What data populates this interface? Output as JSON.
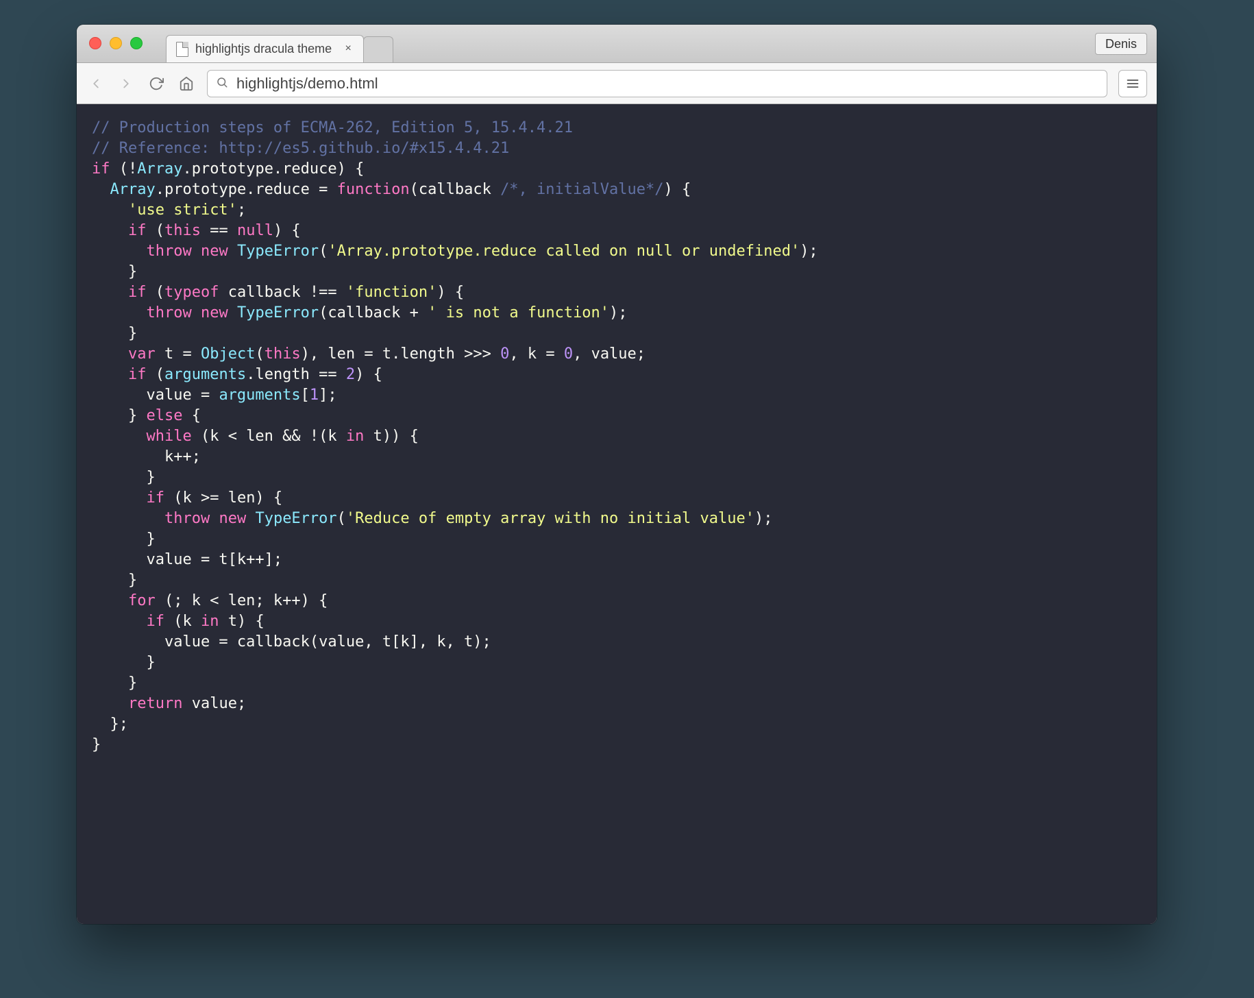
{
  "browser": {
    "tab_title": "highlightjs dracula theme",
    "url": "highlightjs/demo.html",
    "user_chip": "Denis"
  },
  "theme": {
    "name": "dracula",
    "background": "#282a36",
    "colors": {
      "comment": "#6272a4",
      "keyword": "#ff79c6",
      "builtin": "#8be9fd",
      "string": "#f1fa8c",
      "number": "#bd93f9",
      "default": "#f8f8f2"
    }
  },
  "code": {
    "language": "javascript",
    "lines": [
      [
        [
          "comment",
          "// Production steps of ECMA-262, Edition 5, 15.4.4.21"
        ]
      ],
      [
        [
          "comment",
          "// Reference: http://es5.github.io/#x15.4.4.21"
        ]
      ],
      [
        [
          "keyword",
          "if"
        ],
        [
          "default",
          " (!"
        ],
        [
          "builtin",
          "Array"
        ],
        [
          "default",
          ".prototype.reduce) {"
        ]
      ],
      [
        [
          "default",
          "  "
        ],
        [
          "builtin",
          "Array"
        ],
        [
          "default",
          ".prototype.reduce = "
        ],
        [
          "keyword",
          "function"
        ],
        [
          "default",
          "(callback "
        ],
        [
          "comment",
          "/*, initialValue*/"
        ],
        [
          "default",
          ") {"
        ]
      ],
      [
        [
          "default",
          "    "
        ],
        [
          "string",
          "'use strict'"
        ],
        [
          "default",
          ";"
        ]
      ],
      [
        [
          "default",
          "    "
        ],
        [
          "keyword",
          "if"
        ],
        [
          "default",
          " ("
        ],
        [
          "keyword",
          "this"
        ],
        [
          "default",
          " == "
        ],
        [
          "keyword",
          "null"
        ],
        [
          "default",
          ") {"
        ]
      ],
      [
        [
          "default",
          "      "
        ],
        [
          "keyword",
          "throw"
        ],
        [
          "default",
          " "
        ],
        [
          "keyword",
          "new"
        ],
        [
          "default",
          " "
        ],
        [
          "builtin",
          "TypeError"
        ],
        [
          "default",
          "("
        ],
        [
          "string",
          "'Array.prototype.reduce called on null or undefined'"
        ],
        [
          "default",
          ");"
        ]
      ],
      [
        [
          "default",
          "    }"
        ]
      ],
      [
        [
          "default",
          "    "
        ],
        [
          "keyword",
          "if"
        ],
        [
          "default",
          " ("
        ],
        [
          "keyword",
          "typeof"
        ],
        [
          "default",
          " callback !== "
        ],
        [
          "string",
          "'function'"
        ],
        [
          "default",
          ") {"
        ]
      ],
      [
        [
          "default",
          "      "
        ],
        [
          "keyword",
          "throw"
        ],
        [
          "default",
          " "
        ],
        [
          "keyword",
          "new"
        ],
        [
          "default",
          " "
        ],
        [
          "builtin",
          "TypeError"
        ],
        [
          "default",
          "(callback + "
        ],
        [
          "string",
          "' is not a function'"
        ],
        [
          "default",
          ");"
        ]
      ],
      [
        [
          "default",
          "    }"
        ]
      ],
      [
        [
          "default",
          "    "
        ],
        [
          "keyword",
          "var"
        ],
        [
          "default",
          " t = "
        ],
        [
          "builtin",
          "Object"
        ],
        [
          "default",
          "("
        ],
        [
          "keyword",
          "this"
        ],
        [
          "default",
          "), len = t.length >>> "
        ],
        [
          "number",
          "0"
        ],
        [
          "default",
          ", k = "
        ],
        [
          "number",
          "0"
        ],
        [
          "default",
          ", value;"
        ]
      ],
      [
        [
          "default",
          "    "
        ],
        [
          "keyword",
          "if"
        ],
        [
          "default",
          " ("
        ],
        [
          "builtin",
          "arguments"
        ],
        [
          "default",
          ".length == "
        ],
        [
          "number",
          "2"
        ],
        [
          "default",
          ") {"
        ]
      ],
      [
        [
          "default",
          "      value = "
        ],
        [
          "builtin",
          "arguments"
        ],
        [
          "default",
          "["
        ],
        [
          "number",
          "1"
        ],
        [
          "default",
          "];"
        ]
      ],
      [
        [
          "default",
          "    } "
        ],
        [
          "keyword",
          "else"
        ],
        [
          "default",
          " {"
        ]
      ],
      [
        [
          "default",
          "      "
        ],
        [
          "keyword",
          "while"
        ],
        [
          "default",
          " (k < len && !(k "
        ],
        [
          "keyword",
          "in"
        ],
        [
          "default",
          " t)) {"
        ]
      ],
      [
        [
          "default",
          "        k++;"
        ]
      ],
      [
        [
          "default",
          "      }"
        ]
      ],
      [
        [
          "default",
          "      "
        ],
        [
          "keyword",
          "if"
        ],
        [
          "default",
          " (k >= len) {"
        ]
      ],
      [
        [
          "default",
          "        "
        ],
        [
          "keyword",
          "throw"
        ],
        [
          "default",
          " "
        ],
        [
          "keyword",
          "new"
        ],
        [
          "default",
          " "
        ],
        [
          "builtin",
          "TypeError"
        ],
        [
          "default",
          "("
        ],
        [
          "string",
          "'Reduce of empty array with no initial value'"
        ],
        [
          "default",
          ");"
        ]
      ],
      [
        [
          "default",
          "      }"
        ]
      ],
      [
        [
          "default",
          "      value = t[k++];"
        ]
      ],
      [
        [
          "default",
          "    }"
        ]
      ],
      [
        [
          "default",
          "    "
        ],
        [
          "keyword",
          "for"
        ],
        [
          "default",
          " (; k < len; k++) {"
        ]
      ],
      [
        [
          "default",
          "      "
        ],
        [
          "keyword",
          "if"
        ],
        [
          "default",
          " (k "
        ],
        [
          "keyword",
          "in"
        ],
        [
          "default",
          " t) {"
        ]
      ],
      [
        [
          "default",
          "        value = callback(value, t[k], k, t);"
        ]
      ],
      [
        [
          "default",
          "      }"
        ]
      ],
      [
        [
          "default",
          "    }"
        ]
      ],
      [
        [
          "default",
          "    "
        ],
        [
          "keyword",
          "return"
        ],
        [
          "default",
          " value;"
        ]
      ],
      [
        [
          "default",
          "  };"
        ]
      ],
      [
        [
          "default",
          "}"
        ]
      ]
    ]
  }
}
